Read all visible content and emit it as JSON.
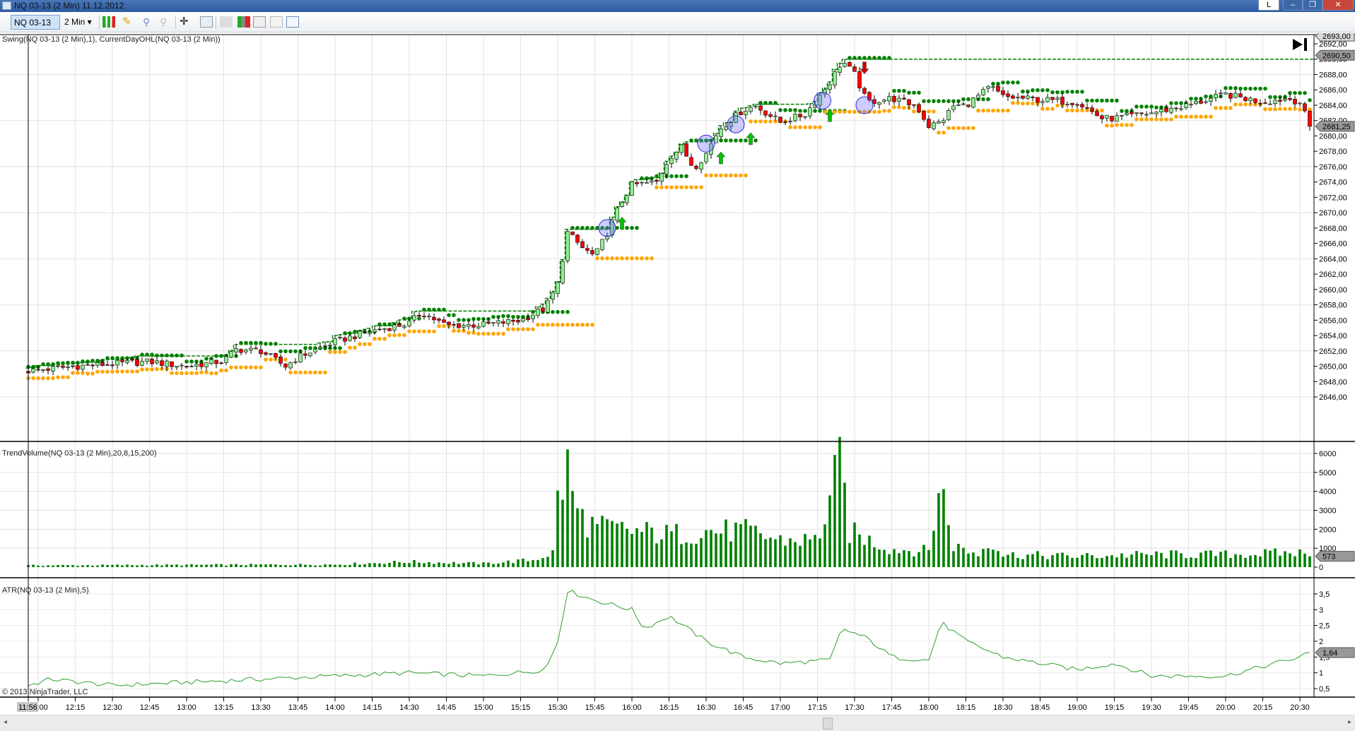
{
  "window": {
    "title": "NQ 03-13 (2 Min)  11.12.2012",
    "buttons": {
      "l_label": "L",
      "minimize": "–",
      "restore": "❐",
      "close": "✕"
    }
  },
  "toolbar": {
    "instrument": "NQ 03-13",
    "interval": "2 Min",
    "icons": [
      "chart-style-icon",
      "drawing-pencil-icon",
      "zoom-in-icon",
      "zoom-out-icon",
      "crosshair-icon",
      "magnifier-icon",
      "data-box-icon",
      "indicators-icon",
      "strategies-icon",
      "properties-icon"
    ]
  },
  "panels": {
    "price_label": "Swing(NQ 03-13 (2 Min),1), CurrentDayOHL(NQ 03-13 (2 Min))",
    "volume_label": "TrendVolume(NQ 03-13 (2 Min),20,8,15,200)",
    "atr_label": "ATR(NQ 03-13 (2 Min),5)",
    "copyright": "© 2013 NinjaTrader, LLC",
    "cursor_time": "11:56",
    "price_markers": [
      "2693,00",
      "2690,50",
      "2681,25"
    ],
    "volume_marker": "573",
    "atr_marker": "1,64"
  },
  "colors": {
    "up": "#90ee90",
    "down": "#ff0000",
    "swing_high": "#008000",
    "swing_low": "#ffa500",
    "volume": "#008000",
    "atr": "#2e9e2e",
    "day_high": "#008000",
    "circle": "#6d6dff"
  },
  "chart_data": [
    {
      "type": "candlestick",
      "panel": "price",
      "bar_interval_min": 2,
      "first_bar": "11:56",
      "last_bar": "20:34",
      "ylim": [
        2645,
        2693
      ],
      "yticks": [
        "2692,00",
        "2690,00",
        "2688,00",
        "2686,00",
        "2684,00",
        "2682,00",
        "2680,00",
        "2678,00",
        "2676,00",
        "2674,00",
        "2672,00",
        "2670,00",
        "2668,00",
        "2666,00",
        "2664,00",
        "2662,00",
        "2660,00",
        "2658,00",
        "2656,00",
        "2654,00",
        "2652,00",
        "2650,00",
        "2648,00",
        "2646,00"
      ],
      "close_path": [
        [
          "11:56",
          2649.4
        ],
        [
          "12:15",
          2650
        ],
        [
          "12:45",
          2650.6
        ],
        [
          "13:00",
          2650
        ],
        [
          "13:15",
          2650.7
        ],
        [
          "13:20",
          2652.2
        ],
        [
          "13:30",
          2652
        ],
        [
          "13:40",
          2650
        ],
        [
          "13:45",
          2651.2
        ],
        [
          "14:00",
          2653.2
        ],
        [
          "14:15",
          2654.6
        ],
        [
          "14:30",
          2655.6
        ],
        [
          "14:35",
          2657
        ],
        [
          "14:45",
          2655.3
        ],
        [
          "15:00",
          2655.4
        ],
        [
          "15:15",
          2656
        ],
        [
          "15:25",
          2657.6
        ],
        [
          "15:30",
          2660.7
        ],
        [
          "15:34",
          2667.4
        ],
        [
          "15:40",
          2665.4
        ],
        [
          "15:45",
          2664.3
        ],
        [
          "15:50",
          2667.4
        ],
        [
          "15:55",
          2671
        ],
        [
          "16:00",
          2673.6
        ],
        [
          "16:10",
          2674
        ],
        [
          "16:15",
          2677.2
        ],
        [
          "16:20",
          2678.5
        ],
        [
          "16:25",
          2675.8
        ],
        [
          "16:30",
          2677.7
        ],
        [
          "16:35",
          2680.8
        ],
        [
          "16:45",
          2683.4
        ],
        [
          "16:50",
          2683.9
        ],
        [
          "17:00",
          2681.8
        ],
        [
          "17:10",
          2682.8
        ],
        [
          "17:15",
          2684.9
        ],
        [
          "17:20",
          2687
        ],
        [
          "17:25",
          2689.8
        ],
        [
          "17:30",
          2688
        ],
        [
          "17:35",
          2684.4
        ],
        [
          "17:45",
          2684.9
        ],
        [
          "17:55",
          2683.9
        ],
        [
          "18:00",
          2681.3
        ],
        [
          "18:05",
          2681.8
        ],
        [
          "18:10",
          2683.9
        ],
        [
          "18:15",
          2684
        ],
        [
          "18:25",
          2686.4
        ],
        [
          "18:30",
          2685.1
        ],
        [
          "18:45",
          2684.7
        ],
        [
          "19:00",
          2684.4
        ],
        [
          "19:10",
          2682.3
        ],
        [
          "19:15",
          2682.3
        ],
        [
          "19:30",
          2683
        ],
        [
          "19:45",
          2684
        ],
        [
          "20:00",
          2685.4
        ],
        [
          "20:15",
          2684.4
        ],
        [
          "20:25",
          2684.9
        ],
        [
          "20:30",
          2684.4
        ],
        [
          "20:34",
          2681.25
        ]
      ],
      "day_high_final": 2690.5,
      "circles": [
        [
          "15:50",
          2668
        ],
        [
          "16:30",
          2679
        ],
        [
          "16:42",
          2681.5
        ],
        [
          "17:17",
          2684.6
        ],
        [
          "17:34",
          2684
        ]
      ],
      "arrows": [
        {
          "time": "15:56",
          "price": 2668.5,
          "dir": "up"
        },
        {
          "time": "16:36",
          "price": 2677,
          "dir": "up"
        },
        {
          "time": "16:48",
          "price": 2679.5,
          "dir": "up"
        },
        {
          "time": "17:20",
          "price": 2682.5,
          "dir": "up"
        },
        {
          "time": "17:34",
          "price": 2689,
          "dir": "down"
        }
      ]
    },
    {
      "type": "bar",
      "panel": "volume",
      "ylim": [
        0,
        6300
      ],
      "yticks": [
        "6000",
        "5000",
        "4000",
        "3000",
        "2000",
        "1000",
        "0"
      ],
      "volume_path": [
        [
          "11:56",
          100
        ],
        [
          "14:00",
          150
        ],
        [
          "14:30",
          300
        ],
        [
          "15:00",
          200
        ],
        [
          "15:20",
          400
        ],
        [
          "15:28",
          800
        ],
        [
          "15:30",
          3800
        ],
        [
          "15:34",
          5400
        ],
        [
          "15:38",
          3000
        ],
        [
          "15:45",
          2200
        ],
        [
          "16:00",
          2000
        ],
        [
          "16:15",
          1800
        ],
        [
          "16:30",
          2000
        ],
        [
          "16:45",
          2000
        ],
        [
          "17:00",
          1500
        ],
        [
          "17:15",
          1500
        ],
        [
          "17:25",
          6000
        ],
        [
          "17:27",
          2000
        ],
        [
          "17:45",
          1000
        ],
        [
          "18:00",
          900
        ],
        [
          "18:04",
          4300
        ],
        [
          "18:06",
          3800
        ],
        [
          "18:10",
          1200
        ],
        [
          "18:20",
          700
        ],
        [
          "18:25",
          1600
        ],
        [
          "18:30",
          700
        ],
        [
          "19:00",
          600
        ],
        [
          "19:30",
          700
        ],
        [
          "20:00",
          700
        ],
        [
          "20:30",
          800
        ],
        [
          "20:34",
          573
        ]
      ]
    },
    {
      "type": "line",
      "panel": "atr",
      "ylim": [
        0.25,
        3.8
      ],
      "yticks": [
        "3,5",
        "3",
        "2,5",
        "2",
        "1,5",
        "1",
        "0,5"
      ],
      "atr_path": [
        [
          "11:56",
          0.6
        ],
        [
          "12:05",
          0.8
        ],
        [
          "12:30",
          0.6
        ],
        [
          "13:00",
          0.7
        ],
        [
          "13:30",
          0.8
        ],
        [
          "14:00",
          0.9
        ],
        [
          "14:30",
          1.0
        ],
        [
          "15:00",
          0.9
        ],
        [
          "15:25",
          1.1
        ],
        [
          "15:30",
          2.0
        ],
        [
          "15:34",
          3.6
        ],
        [
          "15:45",
          3.3
        ],
        [
          "16:00",
          3.0
        ],
        [
          "16:05",
          2.4
        ],
        [
          "16:15",
          2.8
        ],
        [
          "16:30",
          2.0
        ],
        [
          "16:45",
          1.5
        ],
        [
          "17:00",
          1.3
        ],
        [
          "17:20",
          1.4
        ],
        [
          "17:25",
          2.4
        ],
        [
          "17:35",
          2.1
        ],
        [
          "17:45",
          1.5
        ],
        [
          "18:00",
          1.4
        ],
        [
          "18:05",
          2.6
        ],
        [
          "18:15",
          2.0
        ],
        [
          "18:30",
          1.5
        ],
        [
          "19:00",
          1.1
        ],
        [
          "19:15",
          1.3
        ],
        [
          "19:30",
          0.9
        ],
        [
          "20:00",
          0.9
        ],
        [
          "20:15",
          1.2
        ],
        [
          "20:30",
          1.5
        ],
        [
          "20:34",
          1.64
        ]
      ]
    }
  ],
  "time_axis": {
    "labels": [
      "12:00",
      "12:15",
      "12:30",
      "12:45",
      "13:00",
      "13:15",
      "13:30",
      "13:45",
      "14:00",
      "14:15",
      "14:30",
      "14:45",
      "15:00",
      "15:15",
      "15:30",
      "15:45",
      "16:00",
      "16:15",
      "16:30",
      "16:45",
      "17:00",
      "17:15",
      "17:30",
      "17:45",
      "18:00",
      "18:15",
      "18:30",
      "18:45",
      "19:00",
      "19:15",
      "19:30",
      "19:45",
      "20:00",
      "20:15",
      "20:30"
    ]
  }
}
